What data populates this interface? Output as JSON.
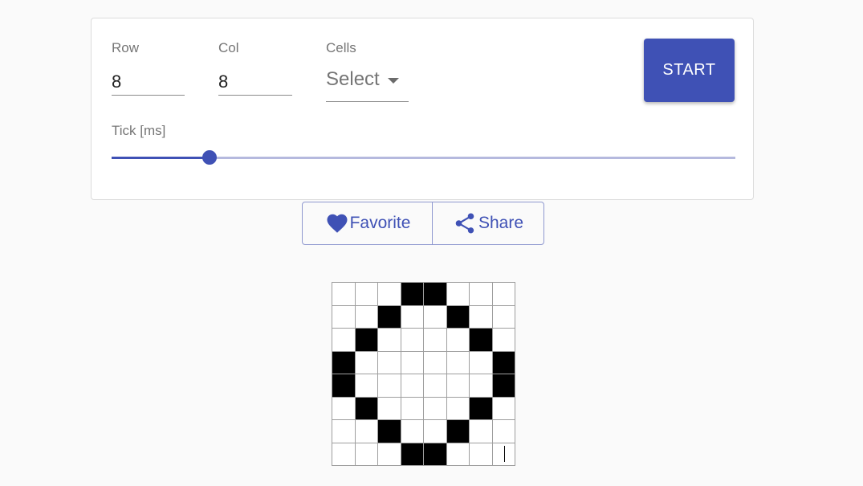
{
  "controls": {
    "row": {
      "label": "Row",
      "value": "8"
    },
    "col": {
      "label": "Col",
      "value": "8"
    },
    "cells": {
      "label": "Cells",
      "selected": "Select"
    },
    "start_label": "START",
    "tick": {
      "label": "Tick [ms]",
      "level_fraction": 0.157
    }
  },
  "actions": {
    "favorite_label": "Favorite",
    "share_label": "Share"
  },
  "colors": {
    "primary": "#3f51b5",
    "alive_cell": "#000000",
    "dead_cell": "#ffffff"
  },
  "grid": {
    "rows": 8,
    "cols": 8,
    "cells": [
      [
        0,
        0,
        0,
        1,
        1,
        0,
        0,
        0
      ],
      [
        0,
        0,
        1,
        0,
        0,
        1,
        0,
        0
      ],
      [
        0,
        1,
        0,
        0,
        0,
        0,
        1,
        0
      ],
      [
        1,
        0,
        0,
        0,
        0,
        0,
        0,
        1
      ],
      [
        1,
        0,
        0,
        0,
        0,
        0,
        0,
        1
      ],
      [
        0,
        1,
        0,
        0,
        0,
        0,
        1,
        0
      ],
      [
        0,
        0,
        1,
        0,
        0,
        1,
        0,
        0
      ],
      [
        0,
        0,
        0,
        1,
        1,
        0,
        0,
        0
      ]
    ]
  }
}
